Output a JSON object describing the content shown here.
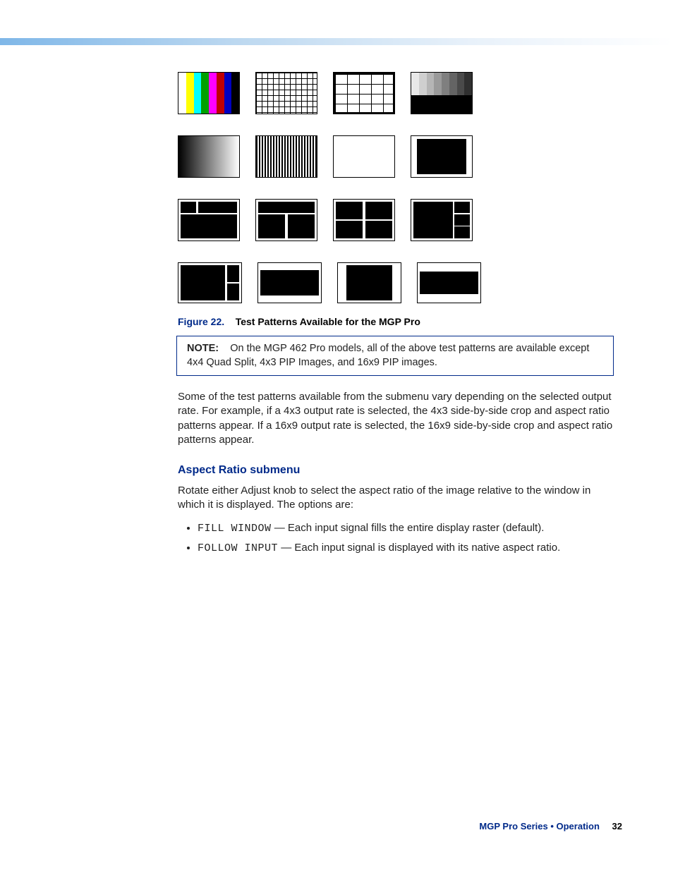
{
  "figure": {
    "label": "Figure 22.",
    "caption": "Test Patterns Available for the MGP Pro"
  },
  "note": {
    "label": "NOTE:",
    "text": "On the MGP 462 Pro models, all of the above test patterns are available except 4x4 Quad Split, 4x3 PIP Images, and 16x9 PIP images."
  },
  "para1": "Some of the test patterns available from the submenu vary depending on the selected output rate. For example, if a 4x3 output rate is selected, the 4x3 side-by-side crop and aspect ratio patterns appear. If a 16x9 output rate is selected, the 16x9 side-by-side crop and aspect ratio patterns appear.",
  "section_heading": "Aspect Ratio submenu",
  "para2": "Rotate either Adjust knob to select the aspect ratio of the image relative to the window in which it is displayed. The options are:",
  "options": [
    {
      "code": "FILL WINDOW",
      "desc": " — Each input signal fills the entire display raster (default)."
    },
    {
      "code": "FOLLOW INPUT",
      "desc": " — Each input signal is displayed with its native aspect ratio."
    }
  ],
  "footer": {
    "text": "MGP Pro Series • Operation",
    "page": "32"
  },
  "patterns": {
    "row1": [
      "color-bars",
      "crosshatch-fine",
      "crosshatch-coarse",
      "grayscale"
    ],
    "row2": [
      "ramp",
      "alt-pixel",
      "white-field",
      "4:3-safe"
    ],
    "row3": [
      "layout-a",
      "layout-b",
      "layout-c",
      "layout-d"
    ],
    "row4": [
      "pip-a",
      "pip-b",
      "pip-c",
      "pip-d"
    ]
  }
}
